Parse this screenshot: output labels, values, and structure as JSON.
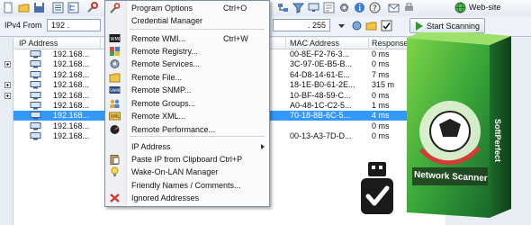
{
  "toolbar": {
    "icons": [
      "new-icon",
      "open-icon",
      "save-icon",
      "list-icon",
      "tree-icon",
      "tools-icon"
    ],
    "web_site_label": "Web-site"
  },
  "address_bar": {
    "range_label": "IPv4 From",
    "from_value": "192 .",
    "to_value": ". 255",
    "start_label": "Start Scanning"
  },
  "table": {
    "columns": [
      "IP Address",
      "MAC Address",
      "Response Time"
    ],
    "rows": [
      {
        "ip": "192.168...",
        "mac": "00-8E-F2-76-3...",
        "response": "0 ms",
        "expand": false,
        "selected": false
      },
      {
        "ip": "192.168...",
        "mac": "3C-97-0E-B5-B...",
        "response": "0 ms",
        "expand": true,
        "selected": false
      },
      {
        "ip": "192.168...",
        "mac": "64-D8-14-61-E...",
        "response": "7 ms",
        "expand": false,
        "selected": false
      },
      {
        "ip": "192.168...",
        "mac": "18-1E-B0-61-2E...",
        "response": "315 m",
        "expand": true,
        "selected": false
      },
      {
        "ip": "192.168...",
        "mac": "10-BF-48-59-C...",
        "response": "0 ms",
        "expand": true,
        "selected": false
      },
      {
        "ip": "192.168...",
        "mac": "A0-48-1C-C2-5...",
        "response": "1 ms",
        "expand": false,
        "selected": false
      },
      {
        "ip": "192.168...",
        "mac": "70-18-8B-6C-5...",
        "response": "4 ms",
        "expand": false,
        "selected": true
      },
      {
        "ip": "192.168...",
        "mac": "",
        "response": "0 ms",
        "expand": false,
        "selected": false
      },
      {
        "ip": "192.168...",
        "mac": "00-13-A3-7D-D...",
        "response": "0 ms",
        "expand": false,
        "selected": false
      }
    ]
  },
  "context_menu": {
    "items": [
      {
        "label": "Program Options",
        "shortcut": "Ctrl+O",
        "icon": "tools-icon"
      },
      {
        "label": "Credential Manager",
        "shortcut": "",
        "icon": ""
      },
      {
        "label": "Remote WMI...",
        "shortcut": "Ctrl+W",
        "icon": "wmi-icon"
      },
      {
        "label": "Remote Registry...",
        "shortcut": "",
        "icon": "registry-icon"
      },
      {
        "label": "Remote Services...",
        "shortcut": "",
        "icon": "services-icon"
      },
      {
        "label": "Remote File...",
        "shortcut": "",
        "icon": "file-icon"
      },
      {
        "label": "Remote SNMP...",
        "shortcut": "",
        "icon": "snmp-icon"
      },
      {
        "label": "Remote Groups...",
        "shortcut": "",
        "icon": "groups-icon"
      },
      {
        "label": "Remote XML...",
        "shortcut": "",
        "icon": "xml-icon"
      },
      {
        "label": "Remote Performance...",
        "shortcut": "",
        "icon": "performance-icon"
      },
      {
        "label": "IP Address",
        "shortcut": "",
        "icon": ""
      },
      {
        "label": "Paste IP from Clipboard Ctrl+P",
        "shortcut": "",
        "icon": "paste-icon"
      },
      {
        "label": "Wake-On-LAN Manager",
        "shortcut": "",
        "icon": "bulb-icon"
      },
      {
        "label": "Friendly Names / Comments...",
        "shortcut": "",
        "icon": ""
      },
      {
        "label": "Ignored Addresses",
        "shortcut": "",
        "icon": "ignore-icon"
      }
    ]
  },
  "product": {
    "title": "Network Scanner",
    "brand": "SoftPerfect"
  }
}
